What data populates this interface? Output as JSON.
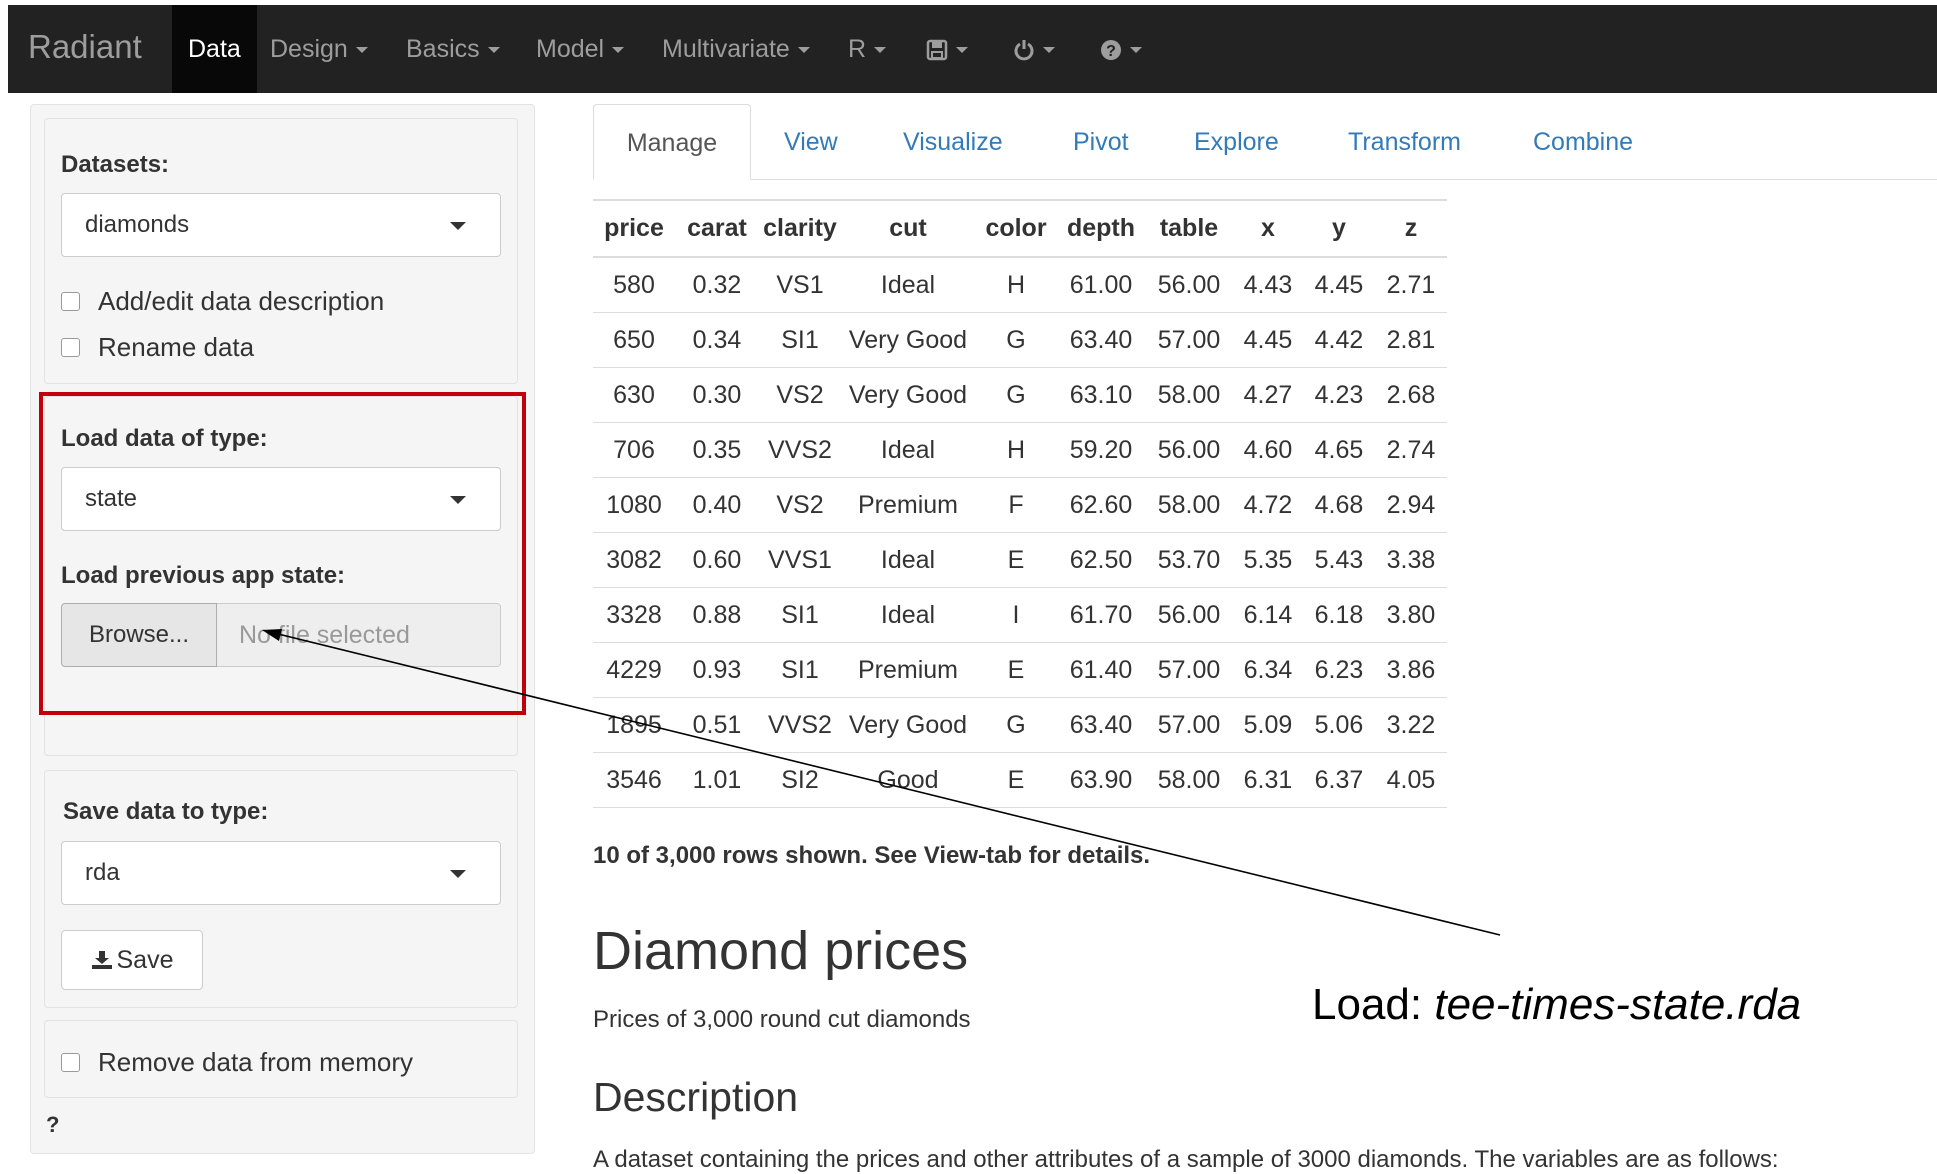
{
  "navbar": {
    "brand": "Radiant",
    "items": [
      {
        "label": "Data"
      },
      {
        "label": "Design"
      },
      {
        "label": "Basics"
      },
      {
        "label": "Model"
      },
      {
        "label": "Multivariate"
      },
      {
        "label": "R"
      }
    ],
    "icons": [
      "save-icon",
      "power-icon",
      "help-icon"
    ]
  },
  "sidebar": {
    "datasets_label": "Datasets:",
    "dataset_value": "diamonds",
    "add_description_label": "Add/edit data description",
    "rename_label": "Rename data",
    "load_type_label": "Load data of type:",
    "load_type_value": "state",
    "load_state_label": "Load previous app state:",
    "browse_label": "Browse...",
    "file_placeholder": "No file selected",
    "save_type_label": "Save data to type:",
    "save_type_value": "rda",
    "save_button_label": "Save",
    "remove_label": "Remove data from memory",
    "help_label": "?"
  },
  "tabs": [
    {
      "label": "Manage",
      "active": true
    },
    {
      "label": "View"
    },
    {
      "label": "Visualize"
    },
    {
      "label": "Pivot"
    },
    {
      "label": "Explore"
    },
    {
      "label": "Transform"
    },
    {
      "label": "Combine"
    }
  ],
  "table": {
    "columns": [
      "price",
      "carat",
      "clarity",
      "cut",
      "color",
      "depth",
      "table",
      "x",
      "y",
      "z"
    ],
    "rows": [
      [
        "580",
        "0.32",
        "VS1",
        "Ideal",
        "H",
        "61.00",
        "56.00",
        "4.43",
        "4.45",
        "2.71"
      ],
      [
        "650",
        "0.34",
        "SI1",
        "Very Good",
        "G",
        "63.40",
        "57.00",
        "4.45",
        "4.42",
        "2.81"
      ],
      [
        "630",
        "0.30",
        "VS2",
        "Very Good",
        "G",
        "63.10",
        "58.00",
        "4.27",
        "4.23",
        "2.68"
      ],
      [
        "706",
        "0.35",
        "VVS2",
        "Ideal",
        "H",
        "59.20",
        "56.00",
        "4.60",
        "4.65",
        "2.74"
      ],
      [
        "1080",
        "0.40",
        "VS2",
        "Premium",
        "F",
        "62.60",
        "58.00",
        "4.72",
        "4.68",
        "2.94"
      ],
      [
        "3082",
        "0.60",
        "VVS1",
        "Ideal",
        "E",
        "62.50",
        "53.70",
        "5.35",
        "5.43",
        "3.38"
      ],
      [
        "3328",
        "0.88",
        "SI1",
        "Ideal",
        "I",
        "61.70",
        "56.00",
        "6.14",
        "6.18",
        "3.80"
      ],
      [
        "4229",
        "0.93",
        "SI1",
        "Premium",
        "E",
        "61.40",
        "57.00",
        "6.34",
        "6.23",
        "3.86"
      ],
      [
        "1895",
        "0.51",
        "VVS2",
        "Very Good",
        "G",
        "63.40",
        "57.00",
        "5.09",
        "5.06",
        "3.22"
      ],
      [
        "3546",
        "1.01",
        "SI2",
        "Good",
        "E",
        "63.90",
        "58.00",
        "6.31",
        "6.37",
        "4.05"
      ]
    ],
    "rows_note": "10 of 3,000 rows shown. See View-tab for details."
  },
  "description": {
    "title": "Diamond prices",
    "subtitle": "Prices of 3,000 round cut diamonds",
    "heading": "Description",
    "text": "A dataset containing the prices and other attributes of a sample of 3000 diamonds. The variables are as follows:"
  },
  "annotation": {
    "prefix": "Load: ",
    "filename": "tee-times-state.rda"
  },
  "colors": {
    "navbar_bg": "#222222",
    "link": "#337ab7",
    "highlight": "#c0000a"
  }
}
